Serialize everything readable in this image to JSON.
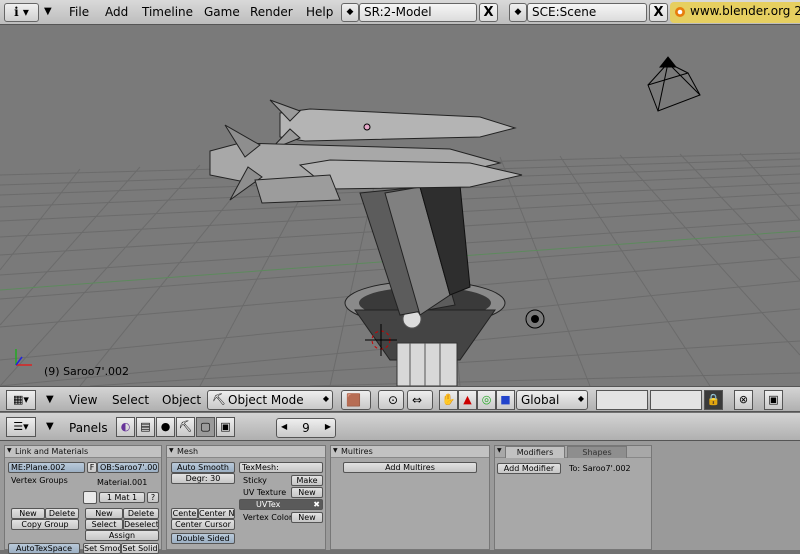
{
  "top_menu": {
    "items": [
      "File",
      "Add",
      "Timeline",
      "Game",
      "Render",
      "Help"
    ],
    "screen": "SR:2-Model",
    "scene": "SCE:Scene",
    "close_label": "X",
    "url": "www.blender.org 2"
  },
  "viewport": {
    "frame_label": "(9) Saroo7'.002"
  },
  "view_header": {
    "menus": [
      "View",
      "Select",
      "Object"
    ],
    "mode": "Object Mode",
    "orientation": "Global"
  },
  "buttons_header": {
    "panels_label": "Panels",
    "frame": "9"
  },
  "panel_link": {
    "title": "Link and Materials",
    "me_field": "ME:Plane.002",
    "f_label": "F",
    "ob_field": "OB:Saroo7'.002",
    "vertex_groups": "Vertex Groups",
    "material": "Material.001",
    "mat_index": "1 Mat 1",
    "q_label": "?",
    "new_label": "New",
    "delete_label": "Delete",
    "copy_group": "Copy Group",
    "select_label": "Select",
    "deselect_label": "Deselect",
    "assign_label": "Assign",
    "autotex": "AutoTexSpace",
    "set_smooth": "Set Smoo",
    "set_solid": "Set Solid"
  },
  "panel_mesh": {
    "title": "Mesh",
    "auto_smooth": "Auto Smooth",
    "degr": "Degr: 30",
    "texmesh": "TexMesh:",
    "sticky": "Sticky",
    "make_label": "Make",
    "uv_texture": "UV Texture",
    "new_label": "New",
    "uvtex": "UVTex",
    "vertex_color": "Vertex Color",
    "new_label2": "New",
    "centre": "Cente",
    "centre_new": "Center Ne",
    "center_cursor": "Center Cursor",
    "double_sided": "Double Sided"
  },
  "panel_multires": {
    "title": "Multires",
    "add_multires": "Add Multires"
  },
  "panel_modifiers": {
    "tab_modifiers": "Modifiers",
    "tab_shapes": "Shapes",
    "add_modifier": "Add Modifier",
    "to_label": "To: Saroo7'.002"
  },
  "colors": {
    "viewport_bg": "#7a7a7a",
    "grid": "#6c6c6c",
    "header": "#c4c4c4",
    "url_pill": "#e6cf60"
  }
}
